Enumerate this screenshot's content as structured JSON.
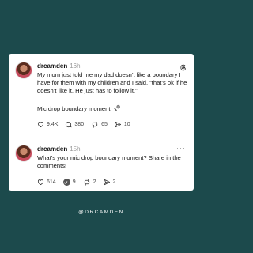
{
  "posts": [
    {
      "username": "drcamden",
      "time": "16h",
      "text": "My mom just told me my dad doesn’t like a boundary I have for them with my children and I said, “that’s ok if he doesn’t like it. He just has to follow it.”",
      "text2": "Mic drop boundary moment.",
      "likes": "9.4K",
      "comments": "380",
      "reposts": "65",
      "shares": "10"
    },
    {
      "username": "drcamden",
      "time": "15h",
      "text": "What’s your mic drop boundary moment? Share in the comments!",
      "likes": "614",
      "comments": "9",
      "reposts": "2",
      "shares": "2"
    }
  ],
  "footer": "@DRCAMDEN",
  "icons": {
    "post1": [
      "avatar",
      "threads-logo-icon",
      "microphone-icon",
      "heart-icon",
      "comment-icon",
      "repost-icon",
      "share-icon"
    ],
    "post2": [
      "avatar",
      "more-icon",
      "heart-icon",
      "comment-replied-icon",
      "repost-icon",
      "share-icon"
    ]
  },
  "colors": {
    "background": "#1c4a4c",
    "card": "#ffffff",
    "text": "#111111",
    "muted": "#9a9a9a"
  }
}
